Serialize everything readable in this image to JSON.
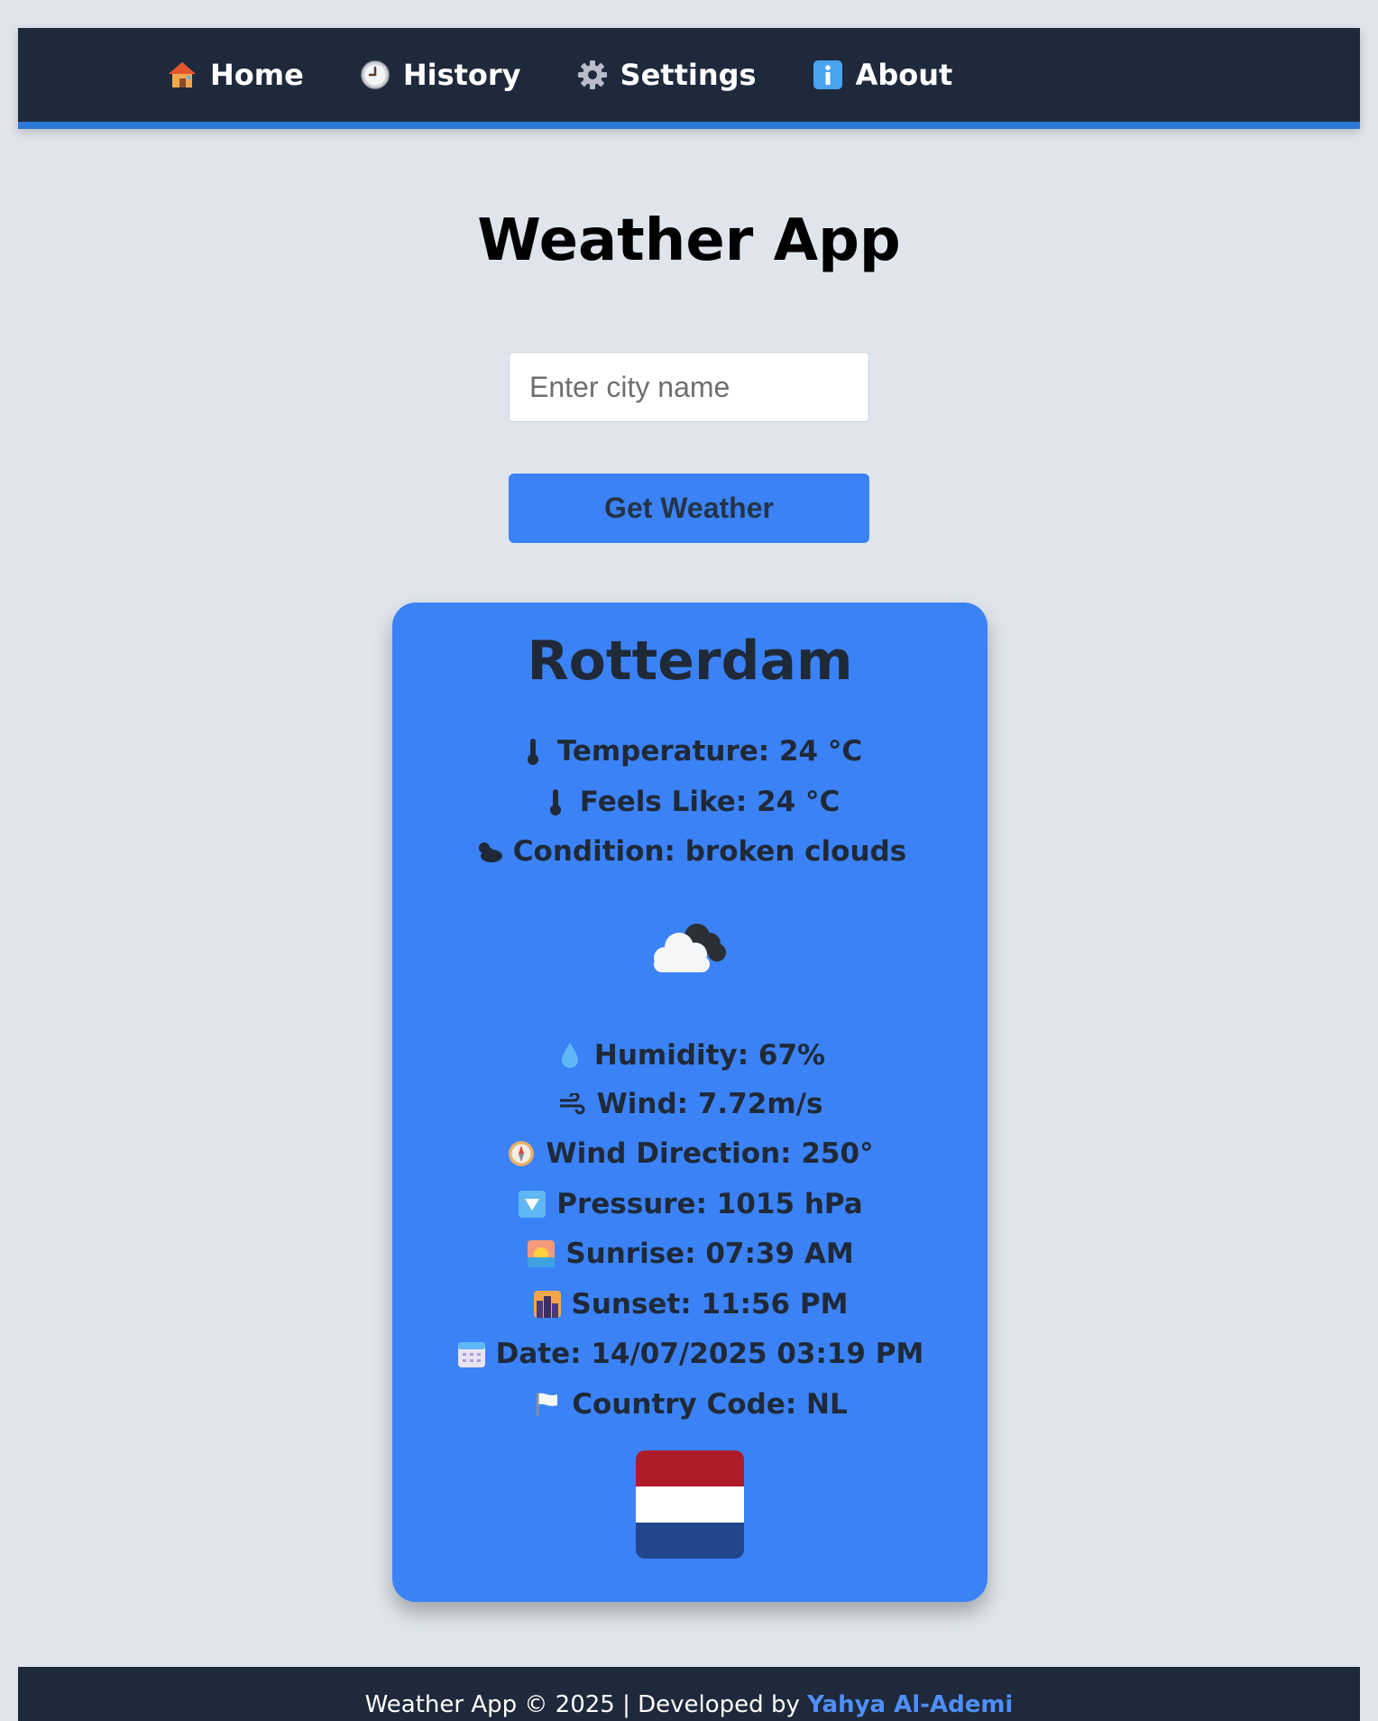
{
  "nav": {
    "items": [
      {
        "label": "Home",
        "icon": "house-icon"
      },
      {
        "label": "History",
        "icon": "clock-icon"
      },
      {
        "label": "Settings",
        "icon": "gear-icon"
      },
      {
        "label": "About",
        "icon": "info-icon"
      }
    ]
  },
  "page": {
    "title": "Weather App"
  },
  "search": {
    "placeholder": "Enter city name",
    "value": "",
    "button_label": "Get Weather"
  },
  "weather": {
    "city": "Rotterdam",
    "temperature": "Temperature: 24 °C",
    "feels_like": "Feels Like: 24 °C",
    "condition": "Condition: broken clouds",
    "humidity": "Humidity: 67%",
    "wind": "Wind: 7.72m/s",
    "wind_direction": "Wind Direction: 250°",
    "pressure": "Pressure: 1015 hPa",
    "sunrise": "Sunrise: 07:39 AM",
    "sunset": "Sunset: 11:56 PM",
    "date": "Date: 14/07/2025 03:19 PM",
    "country_code": "Country Code: NL"
  },
  "flag_colors": [
    "#ae1c28",
    "#ffffff",
    "#21468b"
  ],
  "colors": {
    "nav_bg": "#1e293b",
    "accent": "#3b82f6",
    "page_bg": "#e0e5ed"
  },
  "footer": {
    "text": "Weather App © 2025 | Developed by ",
    "author": "Yahya Al-Ademi"
  }
}
